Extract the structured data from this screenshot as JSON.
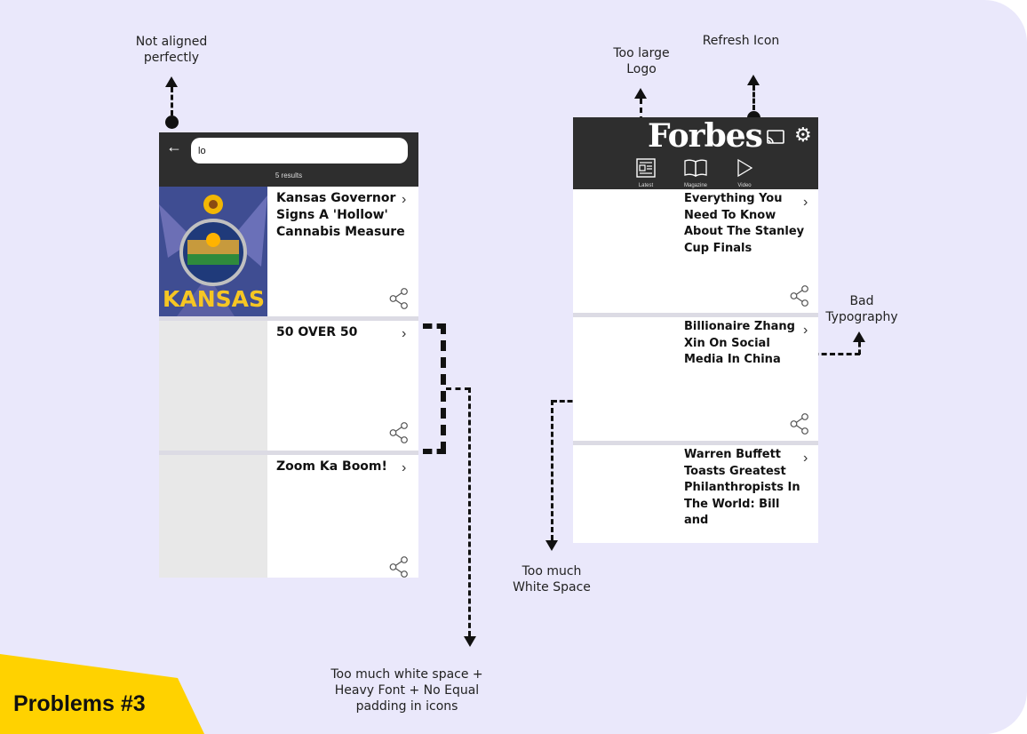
{
  "annotations": {
    "not_aligned": "Not aligned\nperfectly",
    "too_large_logo": "Too large\nLogo",
    "refresh_icon": "Refresh Icon",
    "bad_typography": "Bad\nTypography",
    "too_much_white_space": "Too much\nWhite Space",
    "white_space_heavy_font": "Too much white space +\nHeavy Font + No Equal\npadding in icons"
  },
  "badge": {
    "label": "Problems #3",
    "color": "#ffd200"
  },
  "phone1": {
    "search": {
      "value": "lo"
    },
    "results_text": "5 results",
    "cards": [
      {
        "title": "Kansas Governor Signs A 'Hollow' Cannabis Measure",
        "image": "kansas-flag-image",
        "image_text": "KANSAS"
      },
      {
        "title": "50 OVER 50"
      },
      {
        "title": "Zoom Ka Boom!"
      }
    ]
  },
  "phone2": {
    "logo": "Forbes",
    "nav": [
      {
        "label": "Latest",
        "icon": "newspaper-icon"
      },
      {
        "label": "Magazine",
        "icon": "book-icon"
      },
      {
        "label": "Video",
        "icon": "play-icon"
      }
    ],
    "cards": [
      {
        "title": "Everything You Need To Know About The Stanley Cup Finals"
      },
      {
        "title": "Billionaire Zhang Xin On Social Media In China"
      },
      {
        "title": "Warren Buffett Toasts Greatest Philanthropists In The World: Bill and"
      }
    ]
  },
  "colors": {
    "background": "#eae8fb",
    "header": "#2e2e2e",
    "separator": "#dcdbe4"
  }
}
